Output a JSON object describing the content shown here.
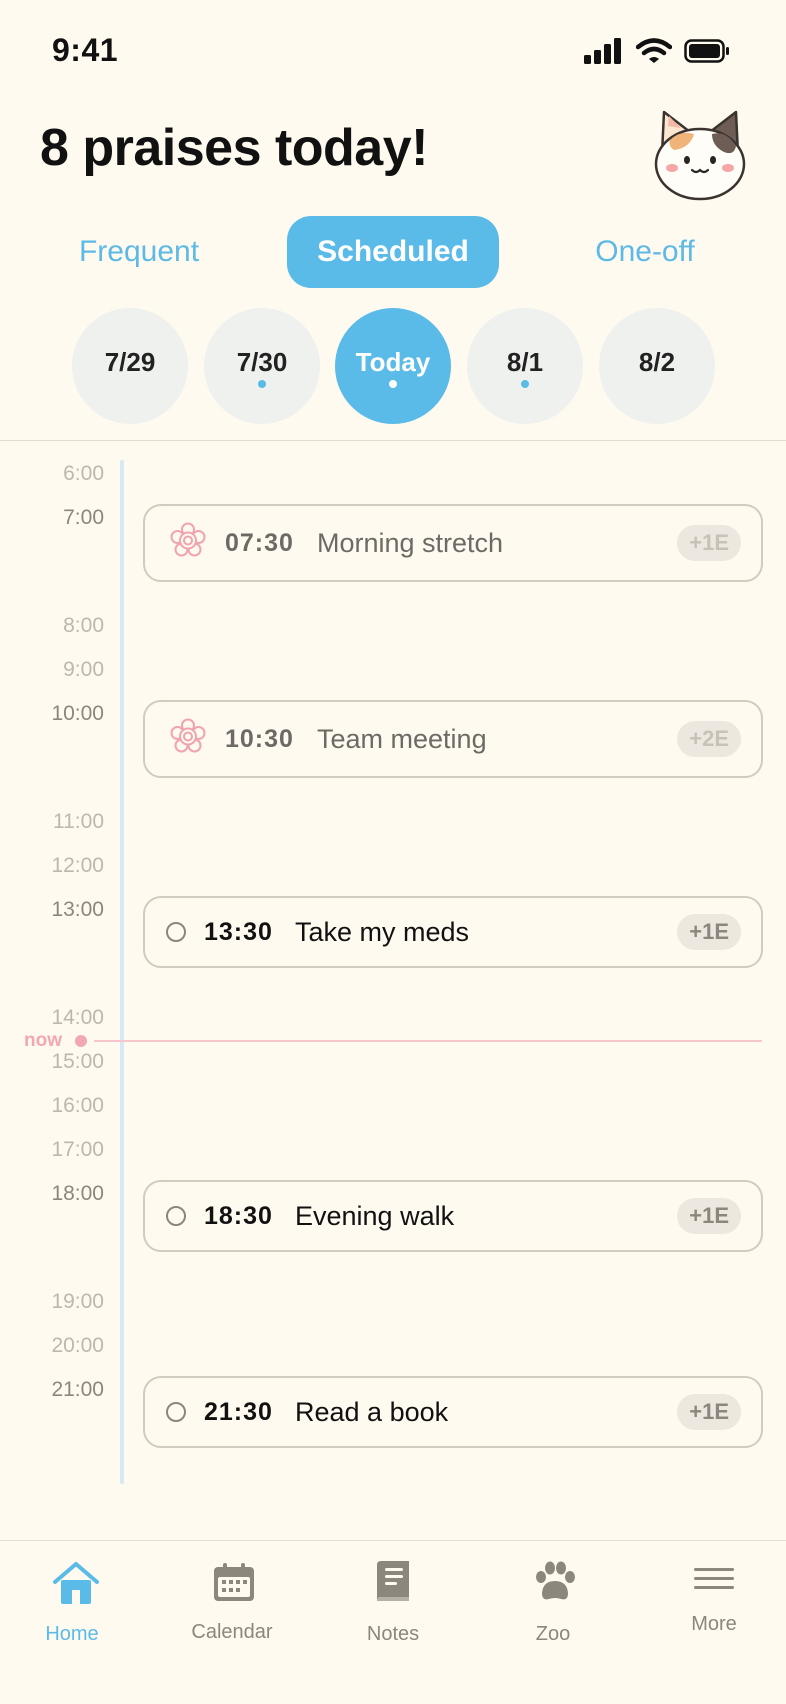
{
  "status_bar": {
    "time": "9:41"
  },
  "header": {
    "title": "8 praises today!"
  },
  "segments": {
    "frequent": "Frequent",
    "scheduled": "Scheduled",
    "one_off": "One-off",
    "selected": "Scheduled"
  },
  "dates": [
    {
      "label": "7/29",
      "has_dot": false,
      "active": false
    },
    {
      "label": "7/30",
      "has_dot": true,
      "active": false
    },
    {
      "label": "Today",
      "has_dot": true,
      "active": true
    },
    {
      "label": "8/1",
      "has_dot": true,
      "active": false
    },
    {
      "label": "8/2",
      "has_dot": false,
      "active": false
    }
  ],
  "timeline": {
    "hours": [
      "6:00",
      "7:00",
      "8:00",
      "9:00",
      "10:00",
      "11:00",
      "12:00",
      "13:00",
      "14:00",
      "15:00",
      "16:00",
      "17:00",
      "18:00",
      "19:00",
      "20:00",
      "21:00"
    ],
    "now_label": "now",
    "events": [
      {
        "time": "07:30",
        "title": "Morning stretch",
        "badge": "+1E",
        "status": "done",
        "icon": "flower-stamp-icon"
      },
      {
        "time": "10:30",
        "title": "Team meeting",
        "badge": "+2E",
        "status": "done",
        "icon": "flower-stamp-icon"
      },
      {
        "time": "13:30",
        "title": "Take my meds",
        "badge": "+1E",
        "status": "todo",
        "icon": "empty-circle-icon"
      },
      {
        "time": "18:30",
        "title": "Evening walk",
        "badge": "+1E",
        "status": "todo",
        "icon": "empty-circle-icon"
      },
      {
        "time": "21:30",
        "title": "Read a book",
        "badge": "+1E",
        "status": "todo",
        "icon": "empty-circle-icon"
      }
    ]
  },
  "tab_bar": {
    "items": [
      {
        "label": "Home",
        "icon": "home-icon",
        "active": true
      },
      {
        "label": "Calendar",
        "icon": "calendar-icon",
        "active": false
      },
      {
        "label": "Notes",
        "icon": "notebook-icon",
        "active": false
      },
      {
        "label": "Zoo",
        "icon": "paw-icon",
        "active": false
      },
      {
        "label": "More",
        "icon": "hamburger-icon",
        "active": false
      }
    ]
  },
  "colors": {
    "accent": "#5bbbe8",
    "background": "#fffaef",
    "now": "#f2a7b4",
    "stamp": "#f0a3b3"
  }
}
